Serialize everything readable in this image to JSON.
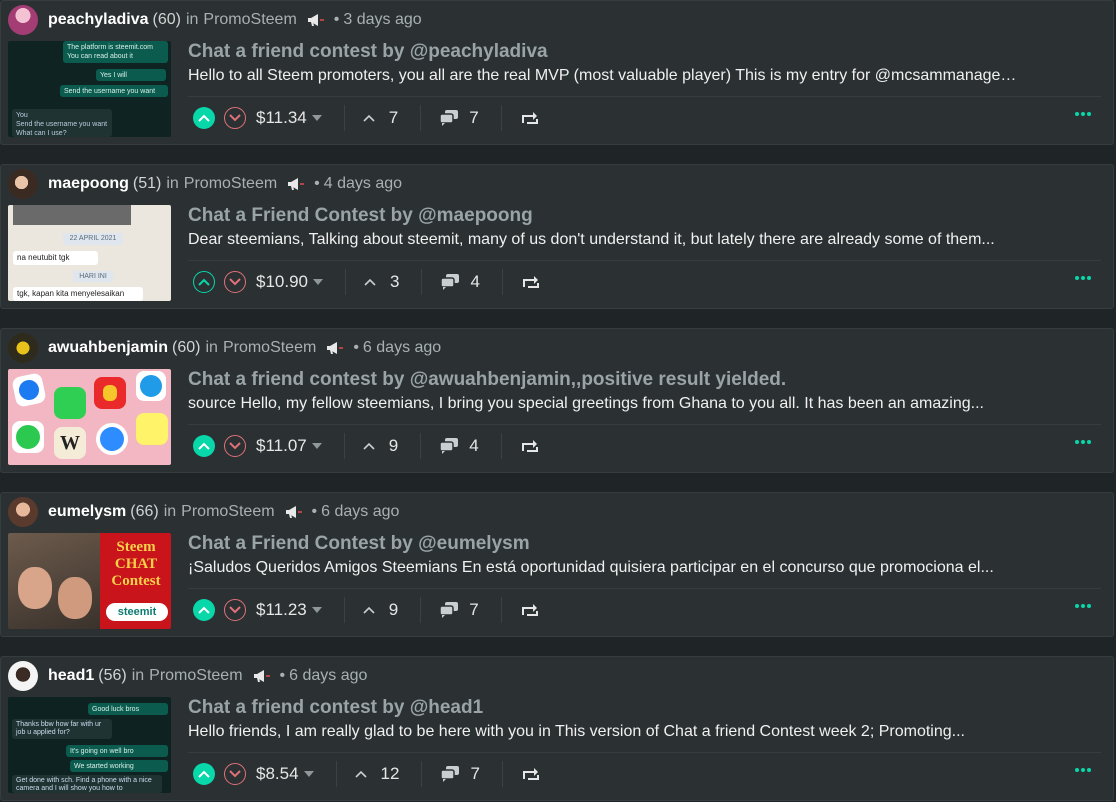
{
  "posts": [
    {
      "author": "peachyladiva",
      "reputation": "(60)",
      "in_label": "in",
      "community": "PromoSteem",
      "time": "3 days ago",
      "title": "Chat a friend contest by @peachyladiva",
      "summary": "Hello to all Steem promoters, you all are the real MVP (most valuable player) This is my entry for @mcsammanager...",
      "payout": "$11.34",
      "votes": "7",
      "replies": "7",
      "upvoted": true,
      "thumb_text": [
        "The platform is steemit.com",
        "You can read about it",
        "Yes I will",
        "Send the username you want",
        "You",
        "Send the username you want",
        "What can I use?"
      ]
    },
    {
      "author": "maepoong",
      "reputation": "(51)",
      "in_label": "in",
      "community": "PromoSteem",
      "time": "4 days ago",
      "title": "Chat a Friend Contest by @maepoong",
      "summary": "Dear steemians, Talking about steemit, many of us don't understand it, but lately there are already some of them...",
      "payout": "$10.90",
      "votes": "3",
      "replies": "4",
      "upvoted": false,
      "thumb_text": [
        "22 APRIL 2021",
        "na neutubit tgk",
        "HARI INI",
        "tgk, kapan kita menyelesaikan"
      ]
    },
    {
      "author": "awuahbenjamin",
      "reputation": "(60)",
      "in_label": "in",
      "community": "PromoSteem",
      "time": "6 days ago",
      "title": "Chat a friend contest by @awuahbenjamin,,positive result yielded.",
      "summary": "source Hello, my fellow steemians, I bring you special greetings from Ghana to you all. It has been an amazing...",
      "payout": "$11.07",
      "votes": "9",
      "replies": "4",
      "upvoted": true,
      "thumb_text": []
    },
    {
      "author": "eumelysm",
      "reputation": "(66)",
      "in_label": "in",
      "community": "PromoSteem",
      "time": "6 days ago",
      "title": "Chat a Friend Contest by @eumelysm",
      "summary": "¡Saludos Queridos Amigos Steemians En está oportunidad quisiera participar en el concurso que promociona el...",
      "payout": "$11.23",
      "votes": "9",
      "replies": "7",
      "upvoted": true,
      "thumb_text": [
        "Steem",
        "CHAT",
        "Contest",
        "steemit"
      ]
    },
    {
      "author": "head1",
      "reputation": "(56)",
      "in_label": "in",
      "community": "PromoSteem",
      "time": "6 days ago",
      "title": "Chat a friend contest by @head1",
      "summary": "Hello friends, I am really glad to be here with you in This version of Chat a friend Contest week 2; Promoting...",
      "payout": "$8.54",
      "votes": "12",
      "replies": "7",
      "upvoted": true,
      "thumb_text": [
        "Good luck bros",
        "Thanks bbw how far with ur job u applied for?",
        "It's going on well bro",
        "We started working",
        "Get done with sch. Find a phone with a nice camera and I will show you how to"
      ]
    }
  ],
  "colors": {
    "background": "#1f2526",
    "card": "#2b3133",
    "accent_upvote": "#07d7a9",
    "downvote": "#e0717a",
    "title": "#9aa3a6"
  },
  "icons": {
    "upvote": "chevron-up-icon",
    "downvote": "chevron-down-icon",
    "votes": "caret-up-icon",
    "replies": "chat-bubbles-icon",
    "resteem": "resteem-icon",
    "community": "megaphone-icon",
    "more": "more-dots-icon"
  },
  "separator": "•"
}
